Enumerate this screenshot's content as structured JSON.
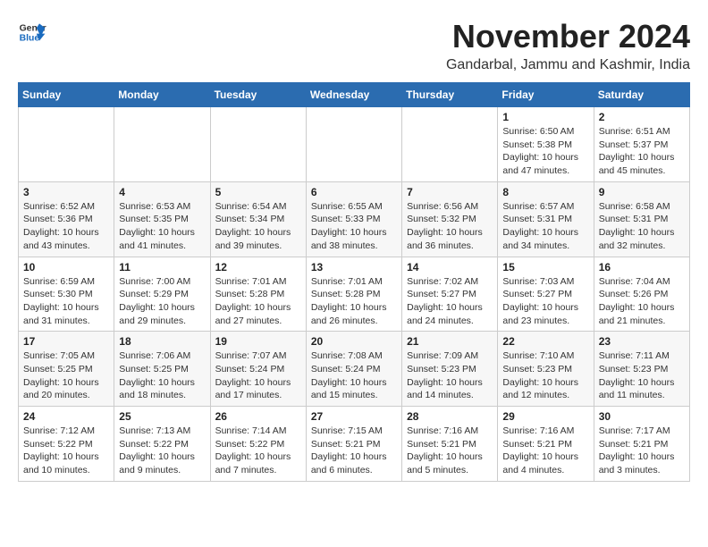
{
  "header": {
    "logo_line1": "General",
    "logo_line2": "Blue",
    "month": "November 2024",
    "location": "Gandarbal, Jammu and Kashmir, India"
  },
  "weekdays": [
    "Sunday",
    "Monday",
    "Tuesday",
    "Wednesday",
    "Thursday",
    "Friday",
    "Saturday"
  ],
  "weeks": [
    [
      {
        "day": "",
        "info": ""
      },
      {
        "day": "",
        "info": ""
      },
      {
        "day": "",
        "info": ""
      },
      {
        "day": "",
        "info": ""
      },
      {
        "day": "",
        "info": ""
      },
      {
        "day": "1",
        "info": "Sunrise: 6:50 AM\nSunset: 5:38 PM\nDaylight: 10 hours and 47 minutes."
      },
      {
        "day": "2",
        "info": "Sunrise: 6:51 AM\nSunset: 5:37 PM\nDaylight: 10 hours and 45 minutes."
      }
    ],
    [
      {
        "day": "3",
        "info": "Sunrise: 6:52 AM\nSunset: 5:36 PM\nDaylight: 10 hours and 43 minutes."
      },
      {
        "day": "4",
        "info": "Sunrise: 6:53 AM\nSunset: 5:35 PM\nDaylight: 10 hours and 41 minutes."
      },
      {
        "day": "5",
        "info": "Sunrise: 6:54 AM\nSunset: 5:34 PM\nDaylight: 10 hours and 39 minutes."
      },
      {
        "day": "6",
        "info": "Sunrise: 6:55 AM\nSunset: 5:33 PM\nDaylight: 10 hours and 38 minutes."
      },
      {
        "day": "7",
        "info": "Sunrise: 6:56 AM\nSunset: 5:32 PM\nDaylight: 10 hours and 36 minutes."
      },
      {
        "day": "8",
        "info": "Sunrise: 6:57 AM\nSunset: 5:31 PM\nDaylight: 10 hours and 34 minutes."
      },
      {
        "day": "9",
        "info": "Sunrise: 6:58 AM\nSunset: 5:31 PM\nDaylight: 10 hours and 32 minutes."
      }
    ],
    [
      {
        "day": "10",
        "info": "Sunrise: 6:59 AM\nSunset: 5:30 PM\nDaylight: 10 hours and 31 minutes."
      },
      {
        "day": "11",
        "info": "Sunrise: 7:00 AM\nSunset: 5:29 PM\nDaylight: 10 hours and 29 minutes."
      },
      {
        "day": "12",
        "info": "Sunrise: 7:01 AM\nSunset: 5:28 PM\nDaylight: 10 hours and 27 minutes."
      },
      {
        "day": "13",
        "info": "Sunrise: 7:01 AM\nSunset: 5:28 PM\nDaylight: 10 hours and 26 minutes."
      },
      {
        "day": "14",
        "info": "Sunrise: 7:02 AM\nSunset: 5:27 PM\nDaylight: 10 hours and 24 minutes."
      },
      {
        "day": "15",
        "info": "Sunrise: 7:03 AM\nSunset: 5:27 PM\nDaylight: 10 hours and 23 minutes."
      },
      {
        "day": "16",
        "info": "Sunrise: 7:04 AM\nSunset: 5:26 PM\nDaylight: 10 hours and 21 minutes."
      }
    ],
    [
      {
        "day": "17",
        "info": "Sunrise: 7:05 AM\nSunset: 5:25 PM\nDaylight: 10 hours and 20 minutes."
      },
      {
        "day": "18",
        "info": "Sunrise: 7:06 AM\nSunset: 5:25 PM\nDaylight: 10 hours and 18 minutes."
      },
      {
        "day": "19",
        "info": "Sunrise: 7:07 AM\nSunset: 5:24 PM\nDaylight: 10 hours and 17 minutes."
      },
      {
        "day": "20",
        "info": "Sunrise: 7:08 AM\nSunset: 5:24 PM\nDaylight: 10 hours and 15 minutes."
      },
      {
        "day": "21",
        "info": "Sunrise: 7:09 AM\nSunset: 5:23 PM\nDaylight: 10 hours and 14 minutes."
      },
      {
        "day": "22",
        "info": "Sunrise: 7:10 AM\nSunset: 5:23 PM\nDaylight: 10 hours and 12 minutes."
      },
      {
        "day": "23",
        "info": "Sunrise: 7:11 AM\nSunset: 5:23 PM\nDaylight: 10 hours and 11 minutes."
      }
    ],
    [
      {
        "day": "24",
        "info": "Sunrise: 7:12 AM\nSunset: 5:22 PM\nDaylight: 10 hours and 10 minutes."
      },
      {
        "day": "25",
        "info": "Sunrise: 7:13 AM\nSunset: 5:22 PM\nDaylight: 10 hours and 9 minutes."
      },
      {
        "day": "26",
        "info": "Sunrise: 7:14 AM\nSunset: 5:22 PM\nDaylight: 10 hours and 7 minutes."
      },
      {
        "day": "27",
        "info": "Sunrise: 7:15 AM\nSunset: 5:21 PM\nDaylight: 10 hours and 6 minutes."
      },
      {
        "day": "28",
        "info": "Sunrise: 7:16 AM\nSunset: 5:21 PM\nDaylight: 10 hours and 5 minutes."
      },
      {
        "day": "29",
        "info": "Sunrise: 7:16 AM\nSunset: 5:21 PM\nDaylight: 10 hours and 4 minutes."
      },
      {
        "day": "30",
        "info": "Sunrise: 7:17 AM\nSunset: 5:21 PM\nDaylight: 10 hours and 3 minutes."
      }
    ]
  ]
}
